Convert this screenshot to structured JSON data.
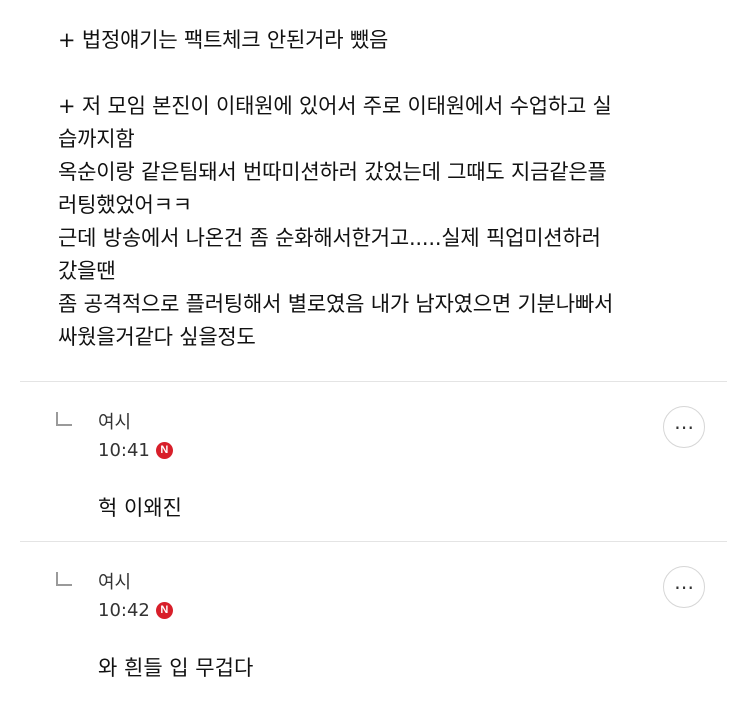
{
  "post": {
    "lines": [
      "+ 법정얘기는 팩트체크 안된거라 뺐음",
      "",
      "+ 저 모임 본진이 이태원에 있어서 주로 이태원에서 수업하고 실",
      "습까지함",
      "옥순이랑 같은팀돼서 번따미션하러 갔었는데 그때도 지금같은플",
      "러팅했었어ㅋㅋ",
      "근데 방송에서 나온건 좀 순화해서한거고.....실제 픽업미션하러",
      "갔을땐",
      "좀 공격적으로 플러팅해서 별로였음 내가 남자였으면 기분나빠서",
      "싸웠을거같다 싶을정도"
    ]
  },
  "comments": [
    {
      "nickname": "여시",
      "time": "10:41",
      "badge": "N",
      "text": "헉 이왜진",
      "more_icon": "⋯"
    },
    {
      "nickname": "여시",
      "time": "10:42",
      "badge": "N",
      "text": "와 흰들 입 무겁다",
      "more_icon": "⋯"
    }
  ],
  "colors": {
    "badge": "#d81f2a",
    "divider": "#e4e4e4",
    "text": "#111111"
  }
}
